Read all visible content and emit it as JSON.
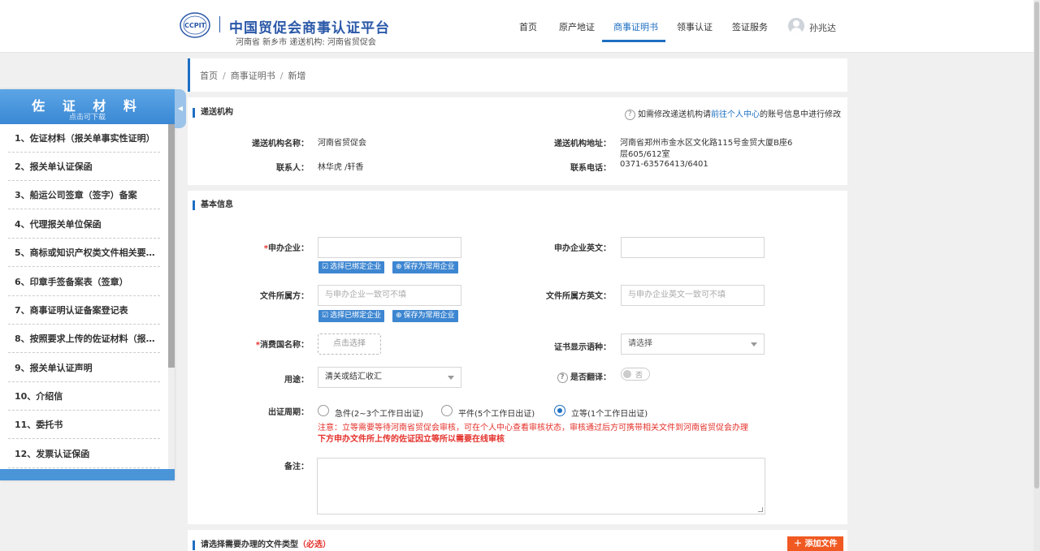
{
  "header": {
    "brand_title": "中国贸促会商事认证平台",
    "brand_sub": "河南省 新乡市 递送机构: 河南省贸促会",
    "logo_text": "CCPIT",
    "nav": [
      "首页",
      "原产地证",
      "商事证明书",
      "领事认证",
      "签证服务"
    ],
    "active_nav": "商事证明书",
    "user_name": "孙兆达"
  },
  "sidebar": {
    "title": "佐 证 材 料",
    "subtitle": "点击可下载",
    "collapse_glyph": "◀",
    "items": [
      "1、佐证材料（报关单事实性证明）",
      "2、报关单认证保函",
      "3、船运公司签章（签字）备案",
      "4、代理报关单位保函",
      "5、商标或知识产权类文件相关要求...",
      "6、印章手签备案表（签章）",
      "7、商事证明认证备案登记表",
      "8、按照要求上传的佐证材料（报关...",
      "9、报关单认证声明",
      "10、介绍信",
      "11、委托书",
      "12、发票认证保函"
    ]
  },
  "breadcrumb": [
    "首页",
    "商事证明书",
    "新增"
  ],
  "breadcrumb_sep": "/",
  "agency": {
    "section_title": "递送机构",
    "tip_prefix": "如需修改递送机构请",
    "tip_link": "前往个人中心",
    "tip_suffix": "的账号信息中进行修改",
    "name_label": "递送机构名称：",
    "name_value": "河南省贸促会",
    "contact_label": "联系人：",
    "contact_value": "林华虎 /轩香",
    "address_label": "递送机构地址：",
    "address_line1": "河南省郑州市金水区文化路115号金贸大厦B座6",
    "address_line2": "层605/612室",
    "phone_label": "联系电话：",
    "phone_value": "0371-63576413/6401"
  },
  "basic": {
    "section_title": "基本信息",
    "required_mark": "*",
    "applicant_label": "申办企业：",
    "applicant_en_label": "申办企业英文：",
    "btn_select_bound": "选择已绑定企业",
    "btn_save_common": "保存为常用企业",
    "owner_label": "文件所属方：",
    "owner_placeholder": "与申办企业一致可不填",
    "owner_en_label": "文件所属方英文：",
    "owner_en_placeholder": "与申办企业英文一致可不填",
    "country_label": "消费国名称：",
    "country_placeholder": "点击选择",
    "lang_label": "证书显示语种：",
    "lang_value": "请选择",
    "purpose_label": "用途：",
    "purpose_value": "清关或结汇收汇",
    "translate_label": "是否翻译：",
    "translate_value": "否",
    "period_label": "出证周期：",
    "period_options": [
      "急件(2~3个工作日出证)",
      "平件(5个工作日出证)",
      "立等(1个工作日出证)"
    ],
    "period_selected": "立等(1个工作日出证)",
    "note_line1": "注意：立等需要等待河南省贸促会审核，可在个人中心查看审核状态，审核通过后方可携带相关文件到河南省贸促会办理",
    "note_line2": "下方申办文件所上传的佐证因立等所以需要在线审核",
    "remark_label": "备注："
  },
  "filetype": {
    "section_title": "请选择需要办理的文件类型",
    "required_tag": "（必选）",
    "add_button": "添加文件"
  },
  "colors": {
    "accent": "#1e6fc2",
    "required": "#e4312b",
    "orange": "#f05a22"
  }
}
